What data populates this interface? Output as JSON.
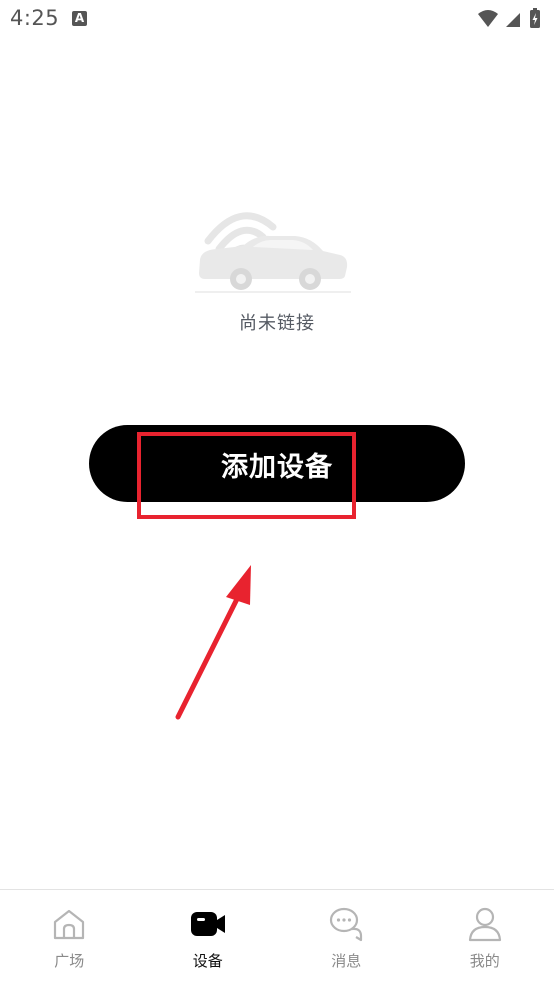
{
  "status_bar": {
    "time": "4:25",
    "notification_icon": "A",
    "icons": [
      "wifi-icon",
      "signal-icon",
      "battery-charging-icon"
    ]
  },
  "empty_state": {
    "illustration_icon": "car-wifi-illustration",
    "text": "尚未链接"
  },
  "add_device": {
    "label": "添加设备"
  },
  "annotation": {
    "color": "#e8232f"
  },
  "tab_bar": {
    "items": [
      {
        "label": "广场",
        "icon": "home-icon",
        "active": false
      },
      {
        "label": "设备",
        "icon": "video-camera-icon",
        "active": true
      },
      {
        "label": "消息",
        "icon": "chat-icon",
        "active": false
      },
      {
        "label": "我的",
        "icon": "user-icon",
        "active": false
      }
    ]
  },
  "colors": {
    "background": "#ffffff",
    "primary_button": "#000000",
    "text_muted": "#555a63",
    "tab_inactive": "#8a8a8a",
    "tab_active": "#111111"
  }
}
